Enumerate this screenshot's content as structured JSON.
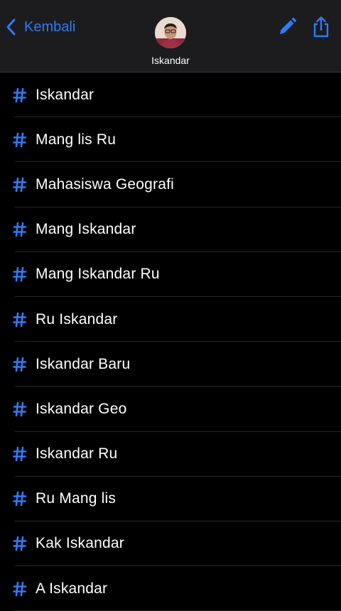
{
  "header": {
    "back_label": "Kembali",
    "contact_name": "Iskandar",
    "accent_color": "#2f7cf6",
    "icons": {
      "back": "chevron-left-icon",
      "edit": "pencil-icon",
      "share": "share-icon"
    }
  },
  "list": {
    "icon": "hash-icon",
    "items": [
      {
        "label": "Iskandar"
      },
      {
        "label": "Mang lis Ru"
      },
      {
        "label": "Mahasiswa Geografi"
      },
      {
        "label": "Mang Iskandar"
      },
      {
        "label": "Mang Iskandar Ru"
      },
      {
        "label": "Ru Iskandar"
      },
      {
        "label": "Iskandar Baru"
      },
      {
        "label": "Iskandar Geo"
      },
      {
        "label": "Iskandar Ru"
      },
      {
        "label": "Ru Mang lis"
      },
      {
        "label": "Kak Iskandar"
      },
      {
        "label": "A Iskandar"
      }
    ]
  }
}
